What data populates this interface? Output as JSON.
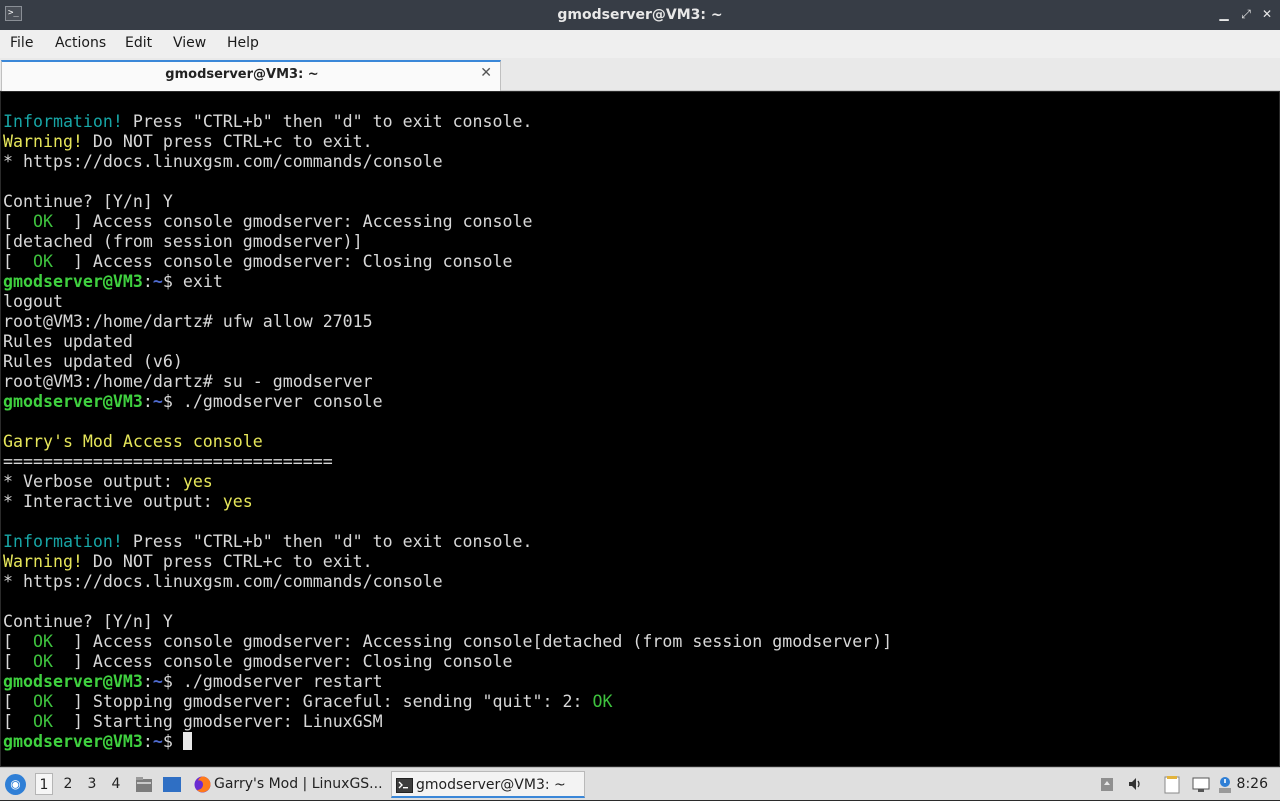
{
  "window": {
    "title": "gmodserver@VM3: ~",
    "app_icon_glyph": ">_",
    "minimize_glyph": "▁",
    "maximize_glyph": "⤢",
    "close_glyph": "✕"
  },
  "menubar": {
    "items": [
      "File",
      "Actions",
      "Edit",
      "View",
      "Help"
    ]
  },
  "tabs": [
    {
      "label": "gmodserver@VM3: ~",
      "close_glyph": "✕"
    }
  ],
  "terminal": {
    "lines": [
      [
        {
          "t": "Information!",
          "c": "cyan"
        },
        {
          "t": " Press \"CTRL+b\" then \"d\" to exit console."
        }
      ],
      [
        {
          "t": "Warning!",
          "c": "yellow"
        },
        {
          "t": " Do NOT press CTRL+c to exit."
        }
      ],
      [
        {
          "t": "* https://docs.linuxgsm.com/commands/console"
        }
      ],
      [],
      [
        {
          "t": "Continue? [Y/n] Y"
        }
      ],
      [
        {
          "t": "[  "
        },
        {
          "t": "OK",
          "c": "green"
        },
        {
          "t": "  ] Access console gmodserver: Accessing console"
        }
      ],
      [
        {
          "t": "[detached (from session gmodserver)]"
        }
      ],
      [
        {
          "t": "[  "
        },
        {
          "t": "OK",
          "c": "green"
        },
        {
          "t": "  ] Access console gmodserver: Closing console"
        }
      ],
      [
        {
          "t": "gmodserver@VM3",
          "c": "prompt"
        },
        {
          "t": ":"
        },
        {
          "t": "~",
          "c": "path"
        },
        {
          "t": "$ exit"
        }
      ],
      [
        {
          "t": "logout"
        }
      ],
      [
        {
          "t": "root@VM3:/home/dartz# ufw allow 27015"
        }
      ],
      [
        {
          "t": "Rules updated"
        }
      ],
      [
        {
          "t": "Rules updated (v6)"
        }
      ],
      [
        {
          "t": "root@VM3:/home/dartz# su - gmodserver"
        }
      ],
      [
        {
          "t": "gmodserver@VM3",
          "c": "prompt"
        },
        {
          "t": ":"
        },
        {
          "t": "~",
          "c": "path"
        },
        {
          "t": "$ ./gmodserver console"
        }
      ],
      [],
      [
        {
          "t": "Garry's Mod Access console",
          "c": "yellow"
        }
      ],
      [
        {
          "t": "================================="
        }
      ],
      [
        {
          "t": "* Verbose output: "
        },
        {
          "t": "yes",
          "c": "yellow"
        }
      ],
      [
        {
          "t": "* Interactive output: "
        },
        {
          "t": "yes",
          "c": "yellow"
        }
      ],
      [],
      [
        {
          "t": "Information!",
          "c": "cyan"
        },
        {
          "t": " Press \"CTRL+b\" then \"d\" to exit console."
        }
      ],
      [
        {
          "t": "Warning!",
          "c": "yellow"
        },
        {
          "t": " Do NOT press CTRL+c to exit."
        }
      ],
      [
        {
          "t": "* https://docs.linuxgsm.com/commands/console"
        }
      ],
      [],
      [
        {
          "t": "Continue? [Y/n] Y"
        }
      ],
      [
        {
          "t": "[  "
        },
        {
          "t": "OK",
          "c": "green"
        },
        {
          "t": "  ] Access console gmodserver: Accessing console[detached (from session gmodserver)]"
        }
      ],
      [
        {
          "t": "[  "
        },
        {
          "t": "OK",
          "c": "green"
        },
        {
          "t": "  ] Access console gmodserver: Closing console"
        }
      ],
      [
        {
          "t": "gmodserver@VM3",
          "c": "prompt"
        },
        {
          "t": ":"
        },
        {
          "t": "~",
          "c": "path"
        },
        {
          "t": "$ ./gmodserver restart"
        }
      ],
      [
        {
          "t": "[  "
        },
        {
          "t": "OK",
          "c": "green"
        },
        {
          "t": "  ] Stopping gmodserver: Graceful: sending \"quit\": 2: "
        },
        {
          "t": "OK",
          "c": "green"
        }
      ],
      [
        {
          "t": "[  "
        },
        {
          "t": "OK",
          "c": "green"
        },
        {
          "t": "  ] Starting gmodserver: LinuxGSM"
        }
      ],
      [
        {
          "t": "gmodserver@VM3",
          "c": "prompt"
        },
        {
          "t": ":"
        },
        {
          "t": "~",
          "c": "path"
        },
        {
          "t": "$ "
        },
        {
          "cursor": true
        }
      ]
    ]
  },
  "taskbar": {
    "workspaces": [
      "1",
      "2",
      "3",
      "4"
    ],
    "active_workspace": "1",
    "tasks": [
      {
        "label": "Garry's Mod | LinuxGS...",
        "icon": "firefox-icon",
        "active": false
      },
      {
        "label": "gmodserver@VM3: ~",
        "icon": "terminal-icon",
        "active": true
      }
    ],
    "clock": "8:26"
  },
  "colors": {
    "accent": "#3a87d8",
    "terminal_bg": "#000000",
    "cyan": "#17a6a6",
    "yellow": "#e6e65a",
    "green": "#3ec23e",
    "prompt": "#3fd13f",
    "path": "#4f6bd0"
  }
}
